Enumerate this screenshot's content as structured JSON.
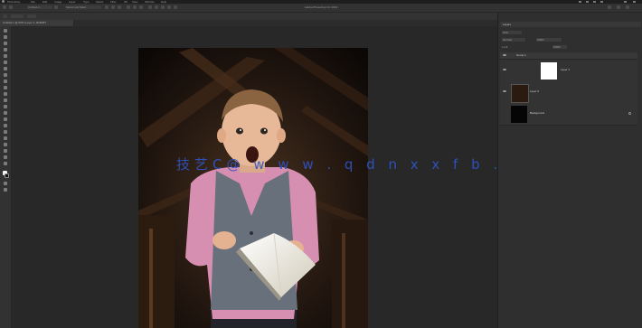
{
  "menubar": {
    "items": [
      "Photoshop",
      "File",
      "Edit",
      "Image",
      "Layer",
      "Type",
      "Select",
      "Filter",
      "3D",
      "View",
      "Window",
      "Help"
    ]
  },
  "app": {
    "title": "Adobe Photoshop CC 2019"
  },
  "titlebar": {
    "left_field": "Untitled-1",
    "workspace_label": "Select and Mask"
  },
  "document": {
    "tab_label": "Untitled-1 @ 50% (Layer 1, RGB/8*)"
  },
  "panels": {
    "layers_tab": "Layers",
    "kind_filter": "Kind",
    "blend_mode": "Normal",
    "opacity": "100%",
    "lock_label": "Lock:",
    "fill": "100%",
    "layers": [
      {
        "name": "Group 1",
        "type": "group"
      },
      {
        "name": "Layer 1",
        "type": "layer-white"
      },
      {
        "name": "Layer 0",
        "type": "layer-photo"
      },
      {
        "name": "Background",
        "type": "layer-black"
      }
    ]
  },
  "watermark": {
    "text": "技艺C@ w w w . q d n x x f b . c n"
  },
  "colors": {
    "watermark": "#2f55c8",
    "chrome_dark": "#1e1e1e",
    "panel_bg": "#2f2f2f",
    "canvas_bg": "#282828"
  }
}
